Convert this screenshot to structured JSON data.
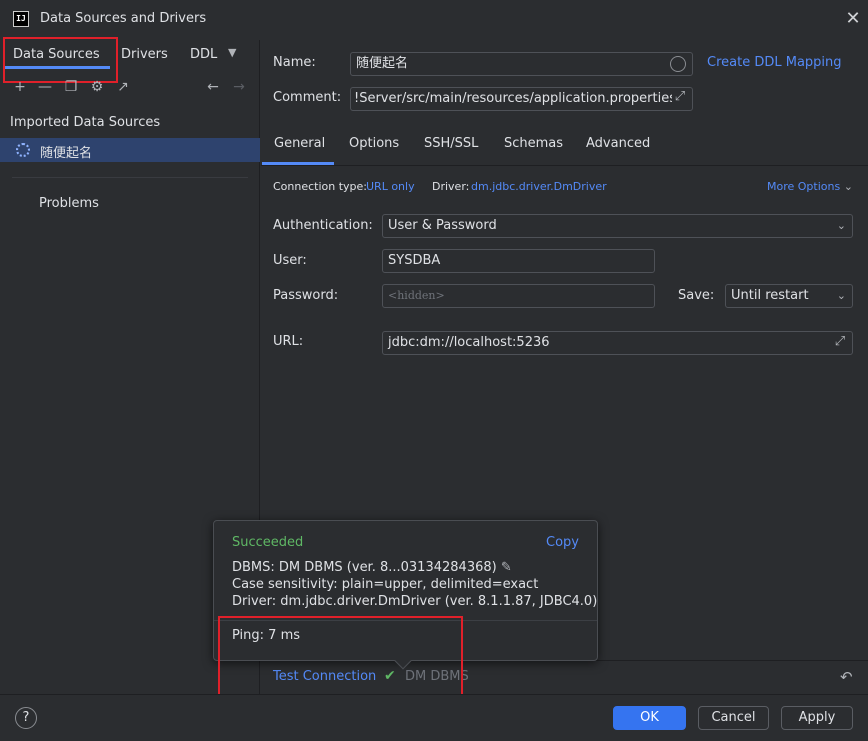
{
  "window": {
    "title": "Data Sources and Drivers",
    "app_icon": "IJ"
  },
  "left": {
    "tabs": [
      "Data Sources",
      "Drivers",
      "DDL"
    ],
    "toolbar_icons": [
      "plus-icon",
      "minus-icon",
      "copy-icon",
      "settings-icon",
      "export-icon",
      "back-icon",
      "forward-icon"
    ],
    "section_title": "Imported Data Sources",
    "datasource_item": "随便起名",
    "problems": "Problems"
  },
  "form": {
    "name_label": "Name:",
    "name_value": "随便起名",
    "create_ddl": "Create DDL Mapping",
    "comment_label": "Comment:",
    "comment_value": "!Server/src/main/resources/application.properties"
  },
  "tabs": [
    "General",
    "Options",
    "SSH/SSL",
    "Schemas",
    "Advanced"
  ],
  "general": {
    "conn_type_label": "Connection type:",
    "conn_type_value": "URL only",
    "driver_label": "Driver:",
    "driver_value": "dm.jdbc.driver.DmDriver",
    "more_options": "More Options",
    "auth_label": "Authentication:",
    "auth_value": "User & Password",
    "user_label": "User:",
    "user_value": "SYSDBA",
    "password_label": "Password:",
    "password_placeholder": "<hidden>",
    "save_label": "Save:",
    "save_value": "Until restart",
    "url_label": "URL:",
    "url_value": "jdbc:dm://localhost:5236"
  },
  "popup": {
    "status": "Succeeded",
    "copy": "Copy",
    "dbms_line": "DBMS: DM DBMS (ver. 8...03134284368)",
    "case_line": "Case sensitivity: plain=upper, delimited=exact",
    "driver_line": "Driver: dm.jdbc.driver.DmDriver (ver. 8.1.1.87, JDBC4.0)",
    "ping": "Ping: 7 ms"
  },
  "bottom": {
    "test_connection": "Test Connection",
    "dbms_name": "DM DBMS"
  },
  "footer": {
    "help": "?",
    "ok": "OK",
    "cancel": "Cancel",
    "apply": "Apply"
  },
  "colors": {
    "accent": "#548af7",
    "success": "#5fb865",
    "highlight": "#e0202a",
    "selection": "#2e436e",
    "primary_button": "#3574f0"
  }
}
